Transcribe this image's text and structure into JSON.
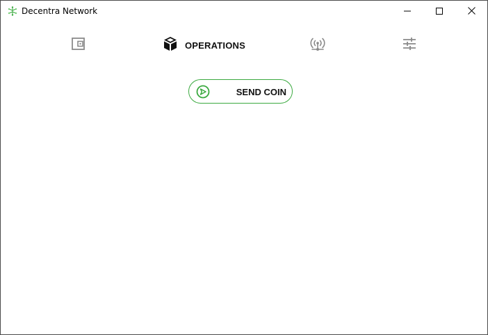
{
  "window": {
    "title": "Decentra Network",
    "accent_color": "#3aa93f"
  },
  "window_controls": {
    "minimize_icon": "minimize-icon",
    "maximize_icon": "maximize-icon",
    "close_icon": "close-icon"
  },
  "nav": {
    "items": [
      {
        "icon": "wallet-icon",
        "label": "",
        "active": false
      },
      {
        "icon": "cube-icon",
        "label": "OPERATIONS",
        "active": true
      },
      {
        "icon": "broadcast-tower-icon",
        "label": "",
        "active": false
      },
      {
        "icon": "sliders-icon",
        "label": "",
        "active": false
      }
    ]
  },
  "actions": {
    "send_coin_label": "SEND COIN",
    "send_coin_icon": "send-arrow-circle-icon"
  }
}
